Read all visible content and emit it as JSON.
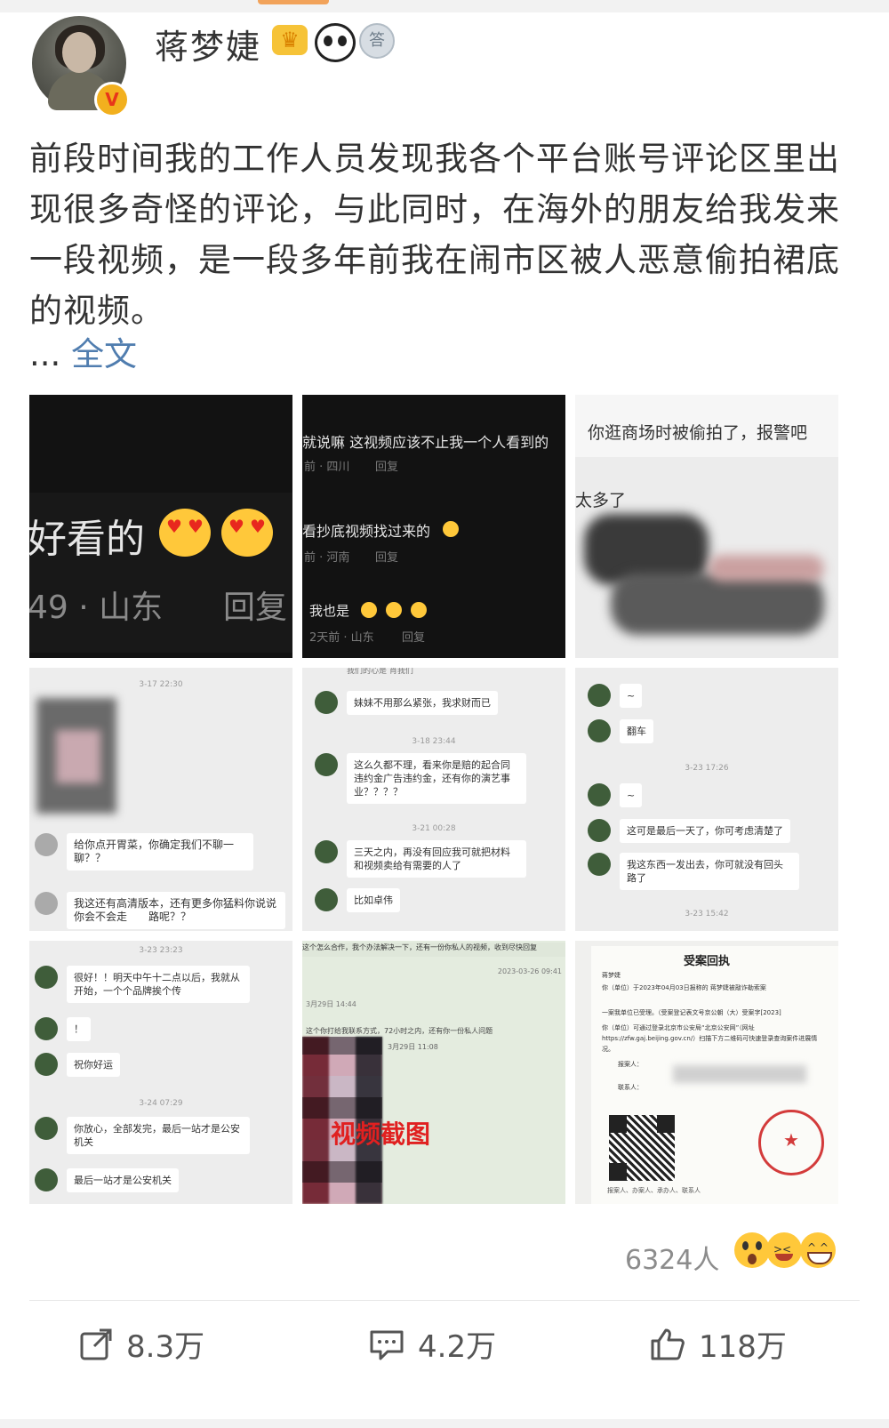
{
  "user": {
    "name": "蒋梦婕",
    "verified_mark": "V",
    "medal_text": "答"
  },
  "post": {
    "text": "前段时间我的工作人员发现我各个平台账号评论区里出现很多奇怪的评论，与此同时，在海外的朋友给我发来一段视频，是一段多年前我在闹市区被人恶意偷拍裙底的视频。",
    "ellipsis": "...",
    "full_text_link": "全文"
  },
  "images": {
    "img1": {
      "text": "好看的",
      "meta": "49 · 山东",
      "reply": "回复"
    },
    "img2": {
      "comments": [
        {
          "text": "就说嘛 这视频应该不止我一个人看到的",
          "meta": "前 · 四川",
          "reply": "回复"
        },
        {
          "text": "看抄底视频找过来的",
          "meta": "前 · 河南",
          "reply": "回复"
        },
        {
          "text": "我也是",
          "meta": "2天前 · 山东",
          "reply": "回复"
        }
      ]
    },
    "img3": {
      "line1": "你逛商场时被偷拍了，报警吧",
      "line2": "太多了"
    },
    "img4": {
      "time": "3-17 22:30",
      "bubbles": [
        "给你点开胃菜，你确定我们不聊一聊？？",
        "我这还有高清版本，还有更多你猛料你说说你会不会走　　路呢？？"
      ]
    },
    "img5": {
      "top": "我们的心是 肖我们",
      "bubbles": [
        "妹妹不用那么紧张，我求财而已",
        "这么久都不理，看来你是赔的起合同违约金广告违约金，还有你的演艺事业？？？？",
        "三天之内，再没有回应我可就把材料和视频卖给有需要的人了",
        "比如卓伟"
      ],
      "times": [
        "3-18 23:44",
        "3-21 00:28"
      ]
    },
    "img6": {
      "bubbles": [
        "~",
        "翻车",
        "~",
        "这可是最后一天了，你可考虑清楚了",
        "我这东西一发出去，你可就没有回头路了"
      ],
      "times": [
        "3-23 17:26",
        "3-23 15:42"
      ]
    },
    "img7": {
      "time1": "3-23 23:23",
      "time2": "3-24 07:29",
      "bubbles": [
        "很好！！明天中午十二点以后，我就从　　开始，一个个品牌挨个传",
        "！",
        "祝你好运",
        "你放心，全部发完，最后一站才是公安机关",
        "最后一站才是公安机关"
      ]
    },
    "img8": {
      "header": "这个怎么合作，我个办法解决一下，还有一份你私人的视频，收到尽快回复",
      "sub1": "2023-03-26 09:41",
      "sub2": "3月29日 14:44",
      "line1": "这个你打给我联系方式，72小时之内，还有你一份私人问题",
      "line2": "3月29日 11:08",
      "overlay": "视频截图"
    },
    "img9": {
      "title": "受案回执",
      "name_line": "蒋梦婕",
      "date_line": "你（单位）于2023年04月03日报称的 蒋梦婕被敲诈勒索案",
      "body1": "一案我单位已受理。（受案登记表文号京公朝（大）受案字[2023]",
      "body2": "你（单位）可通过登录北京市公安局“北京公安网”（网址 https://zfw.gaj.beijing.gov.cn/）扫描下方二维码可快速登录查询案件进展情况。",
      "field1": "报案人：",
      "field2": "联系人：",
      "stamp": "北京市公安局朝阳分局",
      "footer": "报案人、办案人、承办人、联系人"
    }
  },
  "reactions": {
    "count": "6324人"
  },
  "actions": {
    "repost": "8.3万",
    "comment": "4.2万",
    "like": "118万"
  },
  "colors": {
    "link": "#507daf",
    "verified_bg": "#f2b01e",
    "verified_text": "#e8351a",
    "overlay_red": "#e02020"
  }
}
